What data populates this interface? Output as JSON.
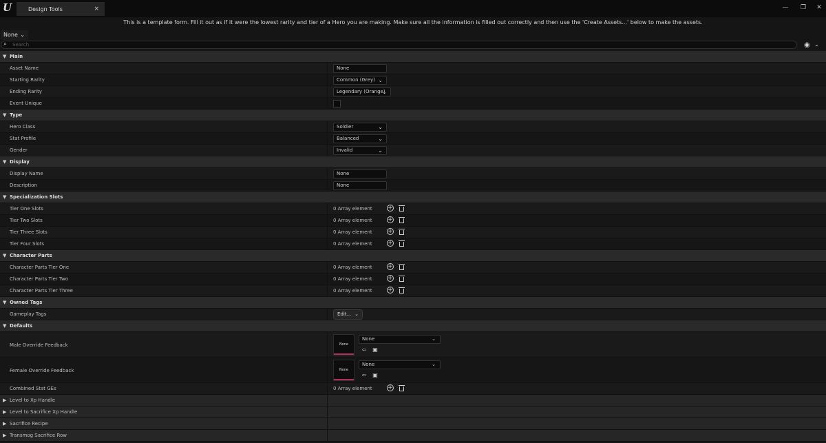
{
  "app": {
    "logo_glyph": "U",
    "tab_title": "Design Tools",
    "tab_close": "×",
    "win_min": "—",
    "win_restore": "❐",
    "win_close": "✕"
  },
  "banner": "This is a template form. Fill it out as if it were the lowest rarity and tier of a Hero you are making. Make sure all the information is filled out correctly and then use the 'Create Assets...' below to make the assets.",
  "filter_combo": {
    "value": "None"
  },
  "search": {
    "placeholder": "Search"
  },
  "sections": {
    "main": {
      "label": "Main",
      "asset_name": {
        "label": "Asset Name",
        "value": "None"
      },
      "starting_rarity": {
        "label": "Starting Rarity",
        "value": "Common (Grey)"
      },
      "ending_rarity": {
        "label": "Ending Rarity",
        "value": "Legendary (Orange)"
      },
      "event_unique": {
        "label": "Event Unique",
        "checked": false
      }
    },
    "type": {
      "label": "Type",
      "hero_class": {
        "label": "Hero Class",
        "value": "Soldier"
      },
      "stat_profile": {
        "label": "Stat Profile",
        "value": "Balanced"
      },
      "gender": {
        "label": "Gender",
        "value": "Invalid"
      }
    },
    "display": {
      "label": "Display",
      "display_name": {
        "label": "Display Name",
        "value": "None"
      },
      "description": {
        "label": "Description",
        "value": "None"
      }
    },
    "specialization": {
      "label": "Specialization Slots",
      "tier_one": {
        "label": "Tier One Slots",
        "value": "0 Array element"
      },
      "tier_two": {
        "label": "Tier Two Slots",
        "value": "0 Array element"
      },
      "tier_three": {
        "label": "Tier Three Slots",
        "value": "0 Array element"
      },
      "tier_four": {
        "label": "Tier Four Slots",
        "value": "0 Array element"
      }
    },
    "character_parts": {
      "label": "Character Parts",
      "tier_one": {
        "label": "Character Parts Tier One",
        "value": "0 Array element"
      },
      "tier_two": {
        "label": "Character Parts Tier Two",
        "value": "0 Array element"
      },
      "tier_three": {
        "label": "Character Parts Tier Three",
        "value": "0 Array element"
      }
    },
    "owned_tags": {
      "label": "Owned Tags",
      "gameplay_tags": {
        "label": "Gameplay Tags",
        "button": "Edit..."
      }
    },
    "defaults": {
      "label": "Defaults",
      "male_override": {
        "label": "Male Override Feedback",
        "thumb": "None",
        "value": "None"
      },
      "female_override": {
        "label": "Female Override Feedback",
        "thumb": "None",
        "value": "None"
      },
      "combined_stat_ges": {
        "label": "Combined Stat GEs",
        "value": "0 Array element"
      }
    },
    "collapsed": [
      "Level to Xp Handle",
      "Level to Sacrifice Xp Handle",
      "Sacrifice Recipe",
      "Transmog Sacrifice Row"
    ]
  },
  "colors": {
    "accent_bar": "#b02e5e",
    "background": "#151515"
  }
}
